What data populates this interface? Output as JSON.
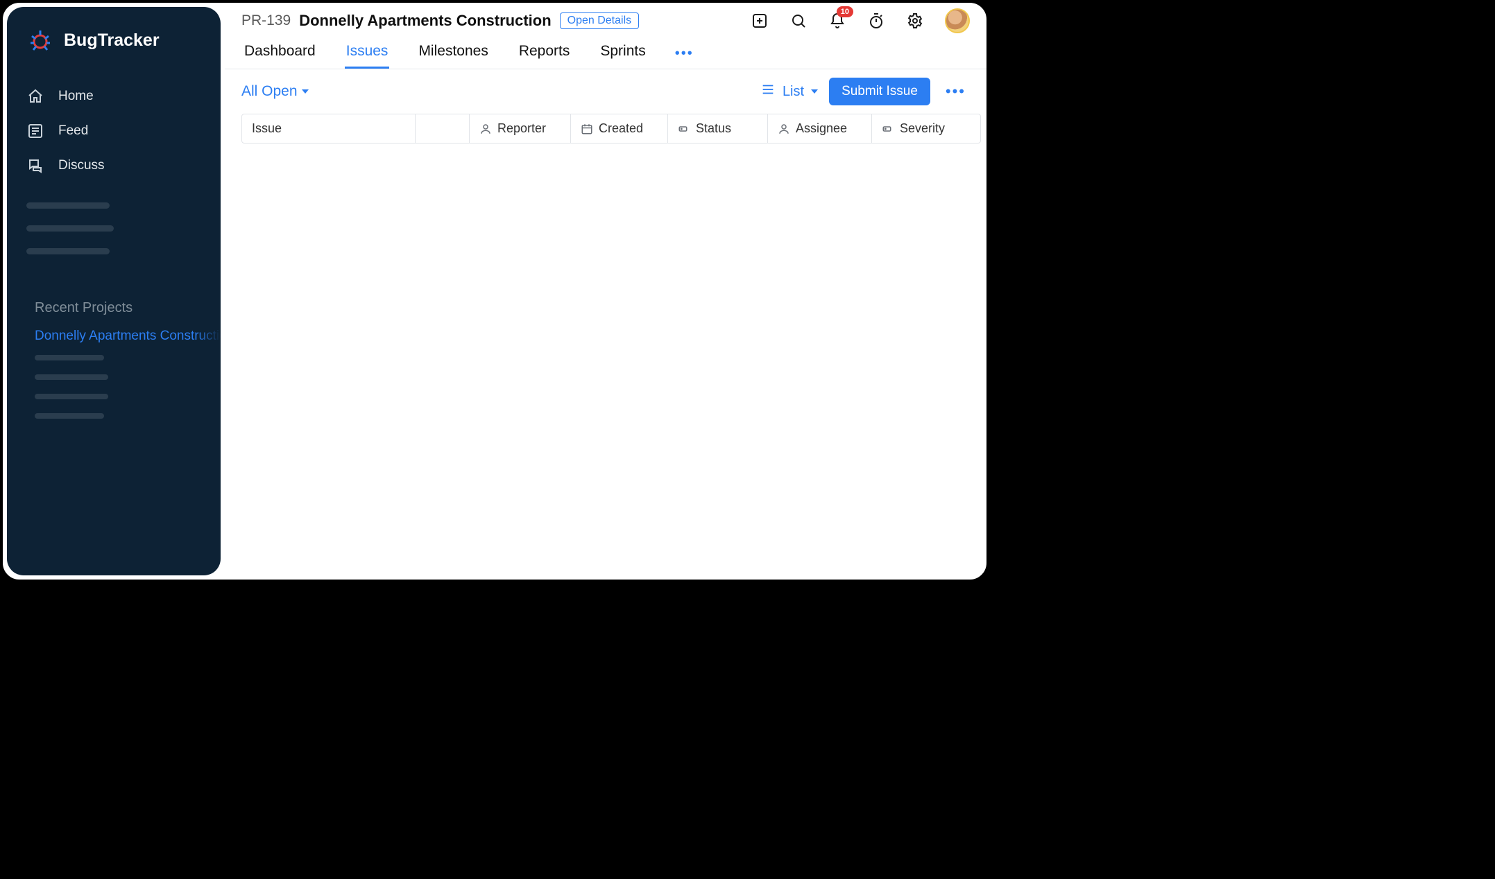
{
  "brand": {
    "name": "BugTracker"
  },
  "sidebar": {
    "nav": {
      "home": "Home",
      "feed": "Feed",
      "discuss": "Discuss"
    },
    "section_title": "Recent Projects",
    "recent_project": "Donnelly Apartments Construction"
  },
  "header": {
    "project_id": "PR-139",
    "project_name": "Donnelly Apartments Construction",
    "open_details": "Open Details",
    "notifications_badge": "10",
    "tabs": {
      "dashboard": "Dashboard",
      "issues": "Issues",
      "milestones": "Milestones",
      "reports": "Reports",
      "sprints": "Sprints"
    }
  },
  "filterbar": {
    "filter_label": "All Open",
    "view_label": "List",
    "submit_label": "Submit Issue"
  },
  "columns": {
    "issue": "Issue",
    "reporter": "Reporter",
    "created": "Created",
    "status": "Status",
    "assignee": "Assignee",
    "severity": "Severity"
  }
}
